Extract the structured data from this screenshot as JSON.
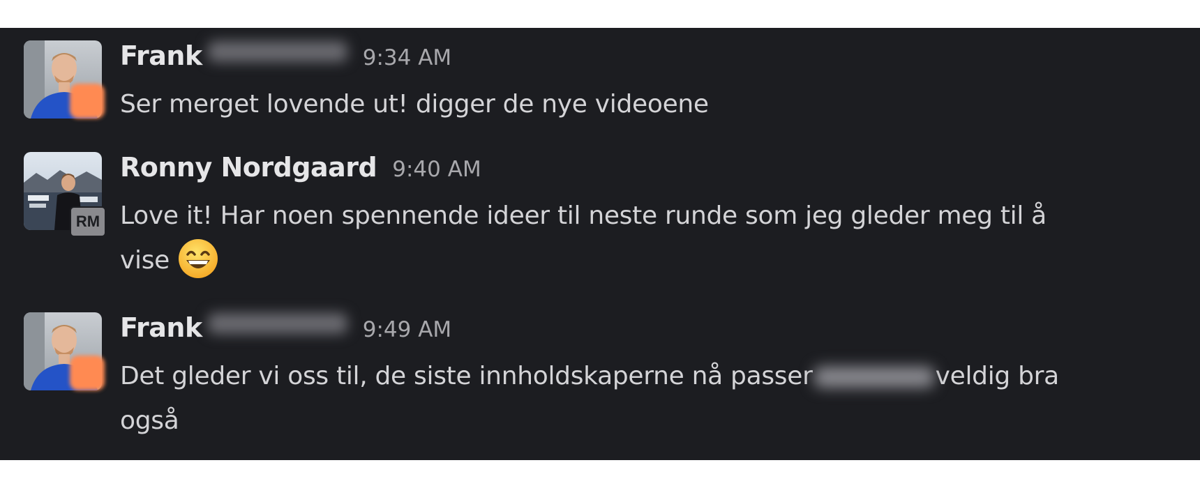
{
  "messages": [
    {
      "author": "Frank",
      "time": "9:34 AM",
      "text": "Ser merget lovende ut! digger de nye videoene"
    },
    {
      "author": "Ronny Nordgaard",
      "time": "9:40 AM",
      "badge": "RM",
      "text_line1": "Love it! Har noen spennende ideer til neste runde som jeg gleder meg til å",
      "text_line2": "vise",
      "emoji": "grinning-face-with-smiling-eyes"
    },
    {
      "author": "Frank",
      "time": "9:49 AM",
      "text_part1": "Det gleder vi oss til, de siste innholdskaperne nå passer",
      "text_part2": "veldig bra",
      "text_line2": "også"
    }
  ],
  "colors": {
    "background": "#1c1d21",
    "text": "#d4d4d7",
    "timestamp": "#a8a8ac",
    "status_badge": "#ff8a52"
  }
}
